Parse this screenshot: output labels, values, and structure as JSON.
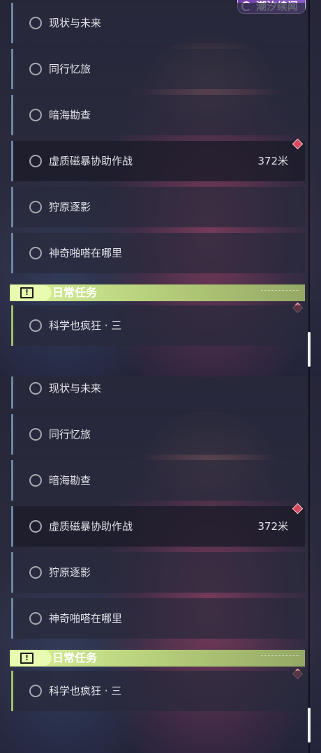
{
  "top_badge": {
    "label": "潮汐续闻",
    "icon": "tide-swirl-icon"
  },
  "quest_icon": "circle-ring-icon",
  "tracked_marker": "red-diamond-icon",
  "accent_colors": {
    "main_quest_bar": "#6d86a3",
    "daily_header": "#c9e38a",
    "marker": "#d6485c"
  },
  "panel_top": {
    "quests": [
      {
        "name": "现状与未来"
      },
      {
        "name": "同行忆旅"
      },
      {
        "name": "暗海勘查"
      },
      {
        "name": "虚质磁暴协助作战",
        "distance": "372米"
      },
      {
        "name": "狩原逐影"
      },
      {
        "name": "神奇啪嗒在哪里"
      }
    ],
    "daily": {
      "title": "日常任务",
      "icon": "exclamation-box-icon",
      "quests": [
        {
          "name": "科学也疯狂 · 三"
        }
      ]
    }
  },
  "panel_bottom": {
    "quests": [
      {
        "name": "现状与未来"
      },
      {
        "name": "同行忆旅"
      },
      {
        "name": "暗海勘查"
      },
      {
        "name": "虚质磁暴协助作战",
        "distance": "372米"
      },
      {
        "name": "狩原逐影"
      },
      {
        "name": "神奇啪嗒在哪里"
      }
    ],
    "daily": {
      "title": "日常任务",
      "icon": "exclamation-box-icon",
      "quests": [
        {
          "name": "科学也疯狂 · 三"
        }
      ]
    }
  }
}
